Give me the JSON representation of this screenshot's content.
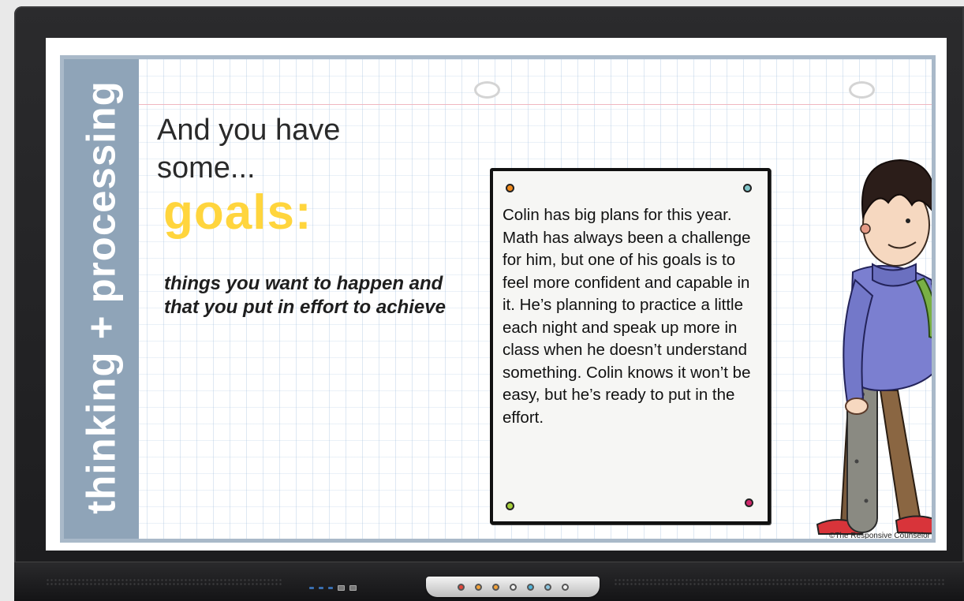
{
  "sidebar": {
    "title": "thinking + processing"
  },
  "slide": {
    "heading_line1": "And you have",
    "heading_line2": "some...",
    "keyword": "goals:",
    "definition": "things you want to happen and that you put in effort to achieve",
    "story": "Colin has big plans for this year. Math has always been a challenge for him, but one of his goals is to feel more confident and capable in it. He’s planning to practice a little each night and speak up more in class when he doesn’t understand something. Colin knows it won’t be easy, but he’s ready to put in the effort.",
    "copyright": "©The Responsive Counselor"
  },
  "colors": {
    "sidebar": "#8fa4b8",
    "keyword": "#ffd53d",
    "frame": "#a9b9c9",
    "pin_orange": "#f08a1c",
    "pin_teal": "#7fc4c8",
    "pin_green": "#a6cf3a",
    "pin_magenta": "#d0276b"
  },
  "icons": {
    "character": "boy-with-skateboard-illustration",
    "pins": "push-pin-dots"
  },
  "control_strip": {
    "buttons": [
      "power-icon",
      "home-icon",
      "input-icon",
      "settings-icon",
      "volume-down-icon",
      "volume-up-icon",
      "menu-icon"
    ]
  }
}
